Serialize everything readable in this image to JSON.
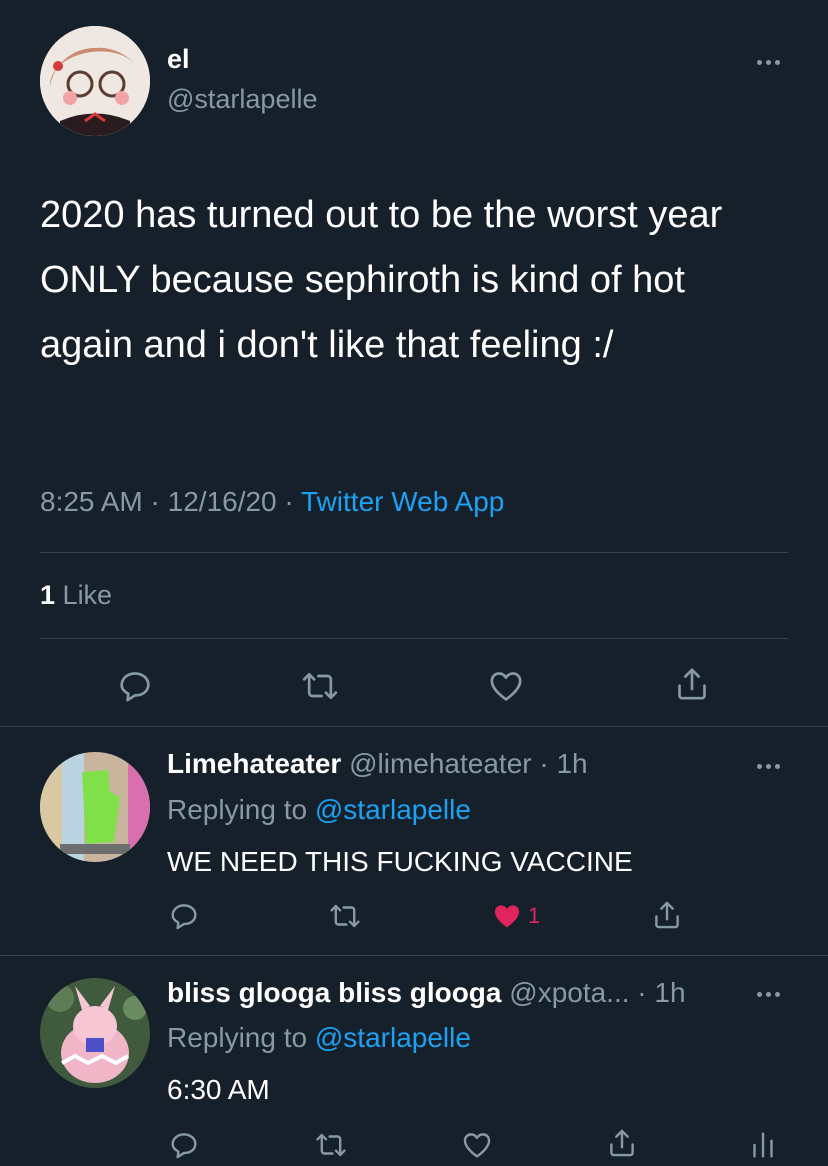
{
  "main_tweet": {
    "display_name": "el",
    "handle": "@starlapelle",
    "text": "2020 has turned out to be the worst year ONLY because sephiroth is kind of hot again and i don't like that feeling :/",
    "time": "8:25 AM",
    "separator1": "·",
    "date": "12/16/20",
    "separator2": "·",
    "source": "Twitter Web App",
    "like_count": "1",
    "like_label": "Like",
    "more_icon": "more-dots-icon",
    "action_icons": [
      "reply-icon",
      "retweet-icon",
      "like-icon",
      "share-icon"
    ]
  },
  "replies": [
    {
      "display_name": "Limehateater",
      "handle_time": "@limehateater · 1h",
      "replying_prefix": "Replying to",
      "replying_to": "@starlapelle",
      "text": "WE NEED THIS FUCKING VACCINE",
      "like_count": "1",
      "liked": true
    },
    {
      "display_name": "bliss glooga bliss glooga",
      "handle_time": "@xpota... · 1h",
      "replying_prefix": "Replying to",
      "replying_to": "@starlapelle",
      "text": "6:30 AM"
    }
  ],
  "colors": {
    "background": "#15202b",
    "text": "#ffffff",
    "muted": "#8899a6",
    "link": "#1da1f2",
    "like_active": "#e0245e",
    "divider": "#38444d"
  }
}
